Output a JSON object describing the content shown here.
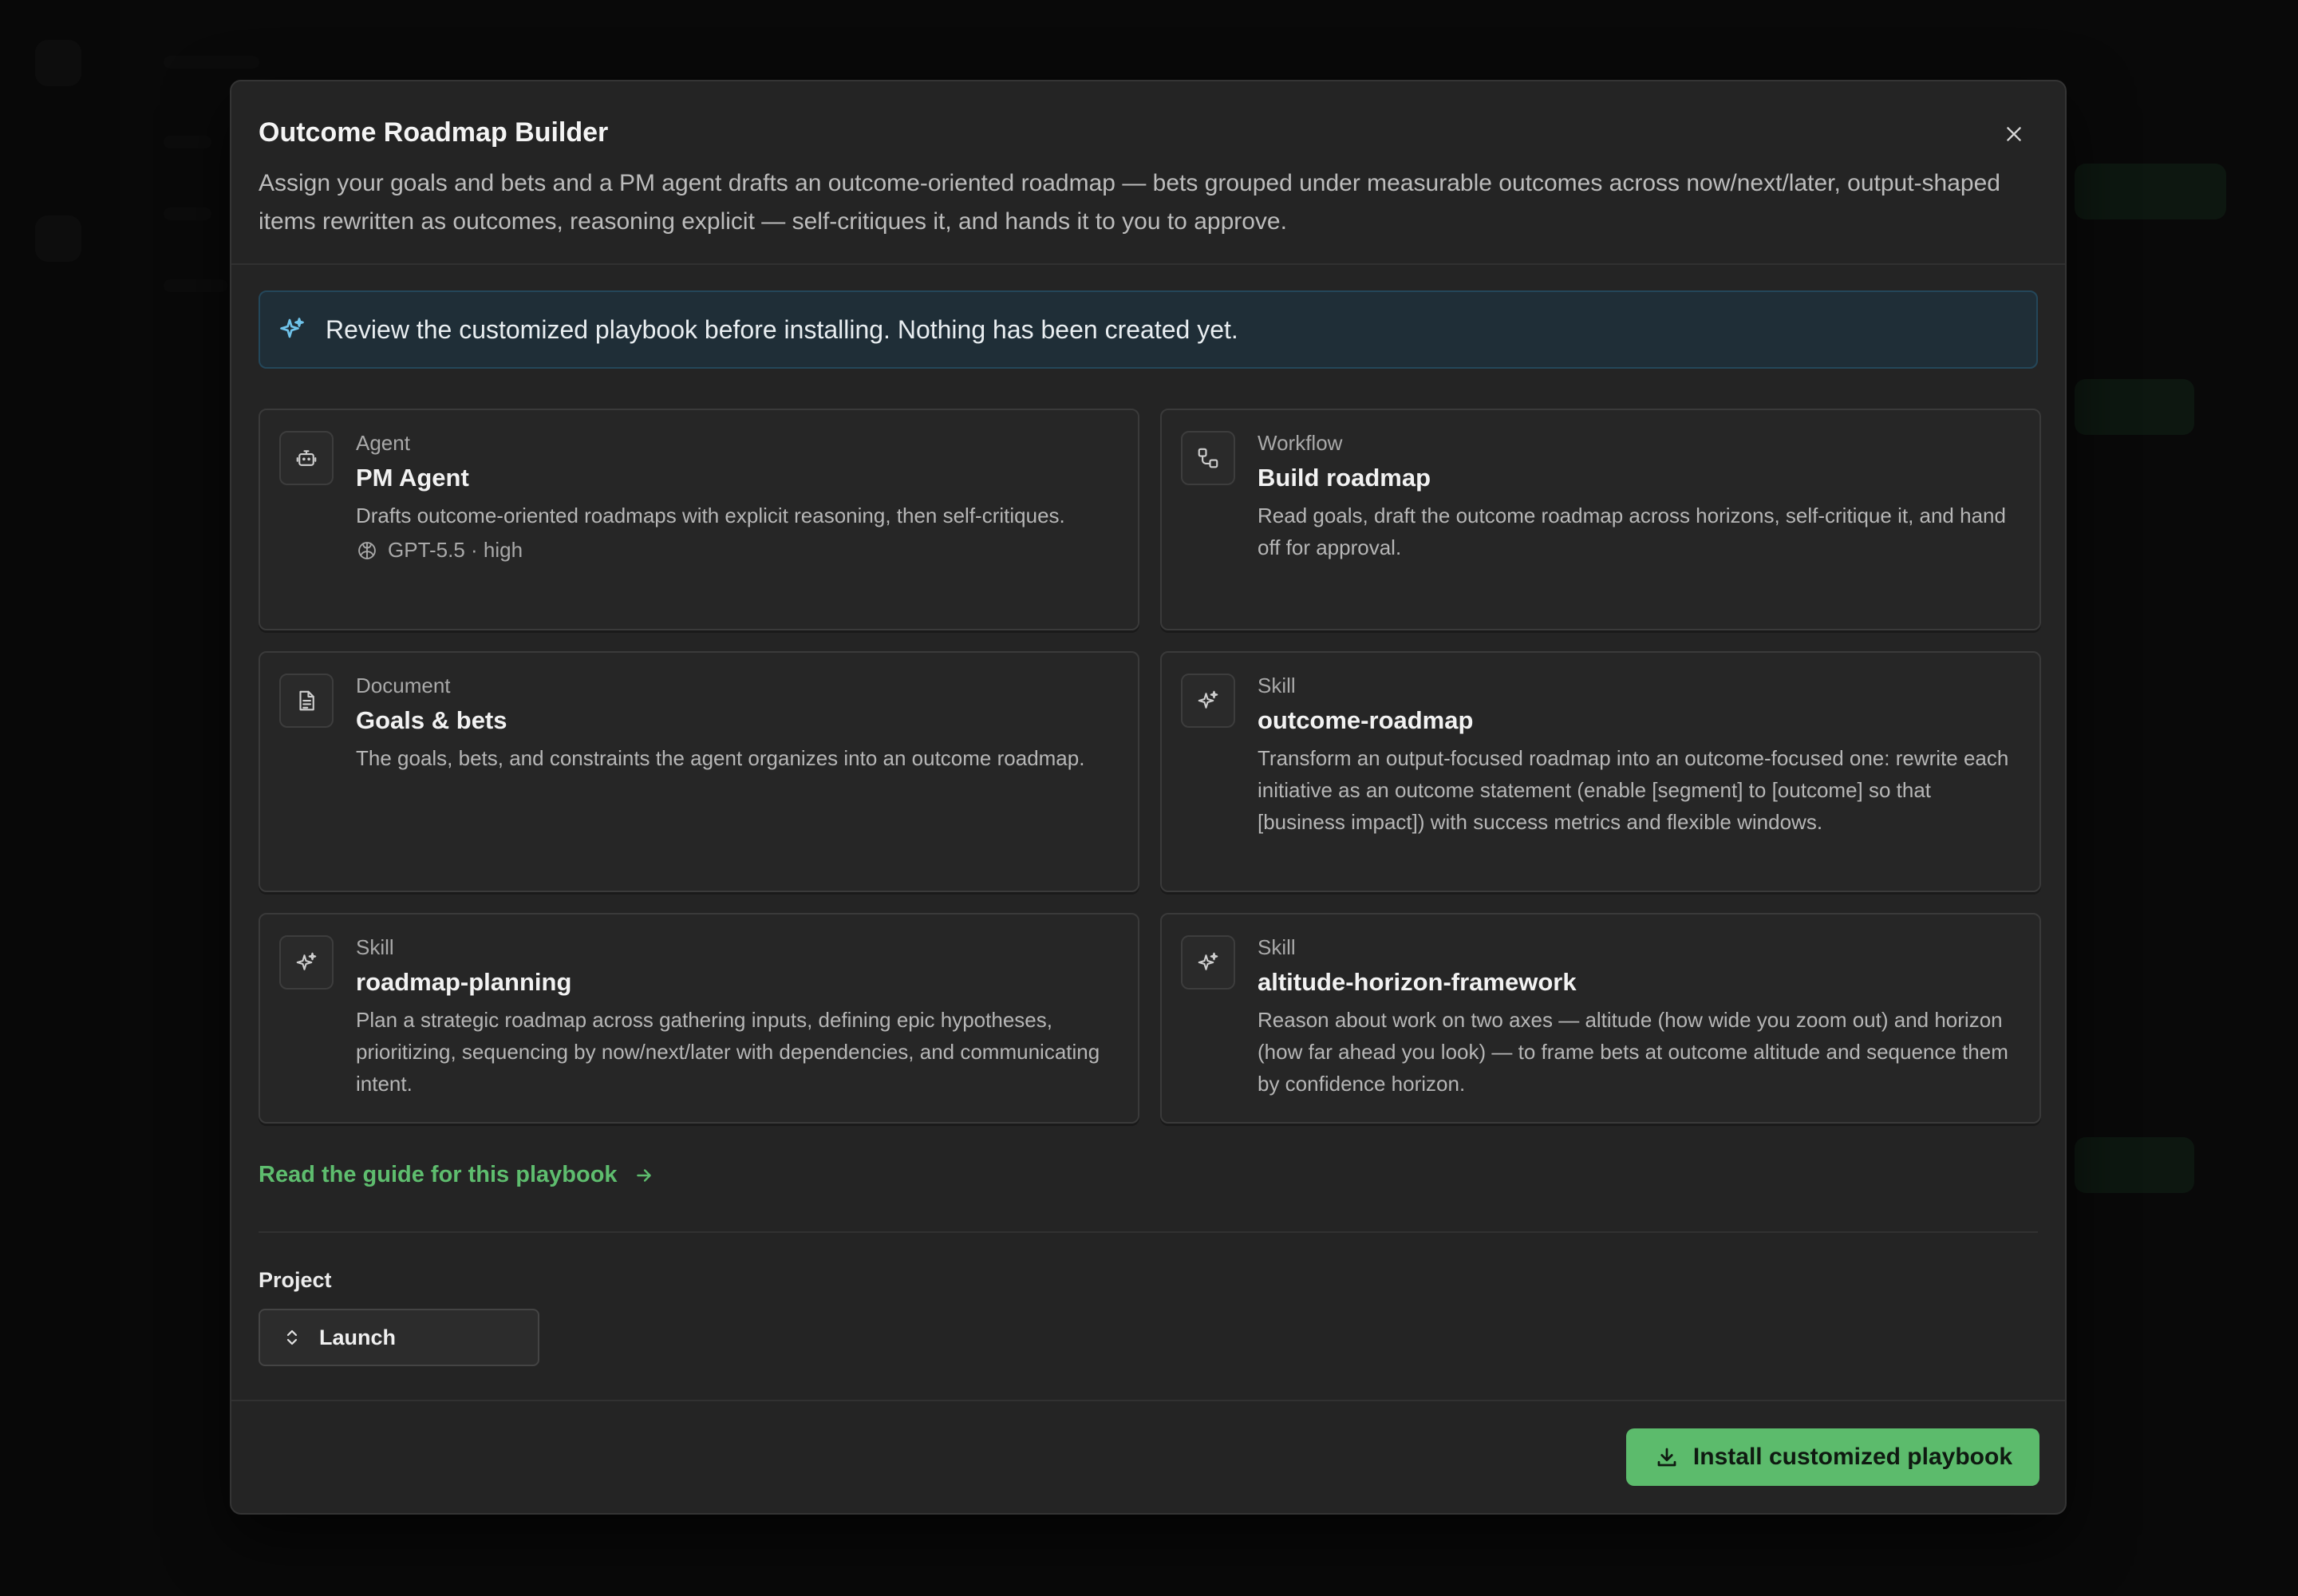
{
  "modal": {
    "title": "Outcome Roadmap Builder",
    "description": "Assign your goals and bets and a PM agent drafts an outcome-oriented roadmap — bets grouped under measurable outcomes across now/next/later, output-shaped items rewritten as outcomes, reasoning explicit — self-critiques it, and hands it to you to approve.",
    "close_icon": "close-icon"
  },
  "notice": {
    "text": "Review the customized playbook before installing. Nothing has been created yet.",
    "icon": "sparkles-icon"
  },
  "cards": [
    {
      "type": "Agent",
      "name": "PM Agent",
      "description": "Drafts outcome-oriented roadmaps with explicit reasoning, then self-critiques.",
      "meta": "GPT-5.5 · high",
      "icon": "robot-icon"
    },
    {
      "type": "Workflow",
      "name": "Build roadmap",
      "description": "Read goals, draft the outcome roadmap across horizons, self-critique it, and hand off for approval.",
      "icon": "workflow-icon"
    },
    {
      "type": "Document",
      "name": "Goals & bets",
      "description": "The goals, bets, and constraints the agent organizes into an outcome roadmap.",
      "icon": "document-icon"
    },
    {
      "type": "Skill",
      "name": "outcome-roadmap",
      "description": "Transform an output-focused roadmap into an outcome-focused one: rewrite each initiative as an outcome statement (enable [segment] to [outcome] so that [business impact]) with success metrics and flexible windows.",
      "icon": "sparkles-icon"
    },
    {
      "type": "Skill",
      "name": "roadmap-planning",
      "description": "Plan a strategic roadmap across gathering inputs, defining epic hypotheses, prioritizing, sequencing by now/next/later with dependencies, and communicating intent.",
      "icon": "sparkles-icon"
    },
    {
      "type": "Skill",
      "name": "altitude-horizon-framework",
      "description": "Reason about work on two axes — altitude (how wide you zoom out) and horizon (how far ahead you look) — to frame bets at outcome altitude and sequence them by confidence horizon.",
      "icon": "sparkles-icon"
    }
  ],
  "guide_link": "Read the guide for this playbook",
  "project": {
    "label": "Project",
    "value": "Launch"
  },
  "install_button": "Install customized playbook",
  "colors": {
    "accent": "#5cbb6c",
    "notice_bg": "#1f2e37",
    "notice_border": "#24475a",
    "modal_bg": "#242424"
  }
}
